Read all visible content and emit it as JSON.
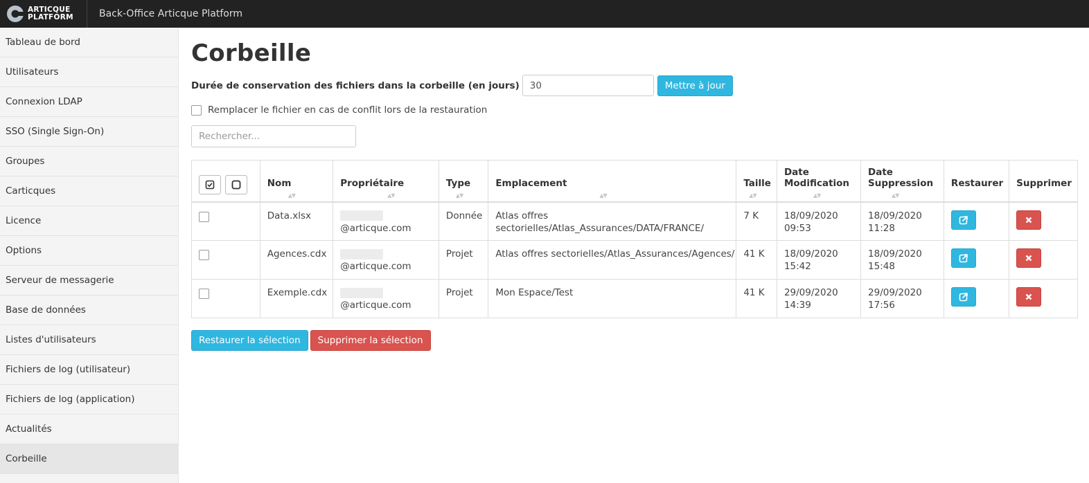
{
  "brand": {
    "logo_line1": "ARTICQUE",
    "logo_line2": "PLATFORM",
    "app_title": "Back-Office Articque Platform"
  },
  "sidebar": {
    "items": [
      {
        "label": "Tableau de bord"
      },
      {
        "label": "Utilisateurs"
      },
      {
        "label": "Connexion LDAP"
      },
      {
        "label": "SSO (Single Sign-On)"
      },
      {
        "label": "Groupes"
      },
      {
        "label": "Carticques"
      },
      {
        "label": "Licence"
      },
      {
        "label": "Options"
      },
      {
        "label": "Serveur de messagerie"
      },
      {
        "label": "Base de données"
      },
      {
        "label": "Listes d'utilisateurs"
      },
      {
        "label": "Fichiers de log (utilisateur)"
      },
      {
        "label": "Fichiers de log (application)"
      },
      {
        "label": "Actualités"
      },
      {
        "label": "Corbeille",
        "active": true
      }
    ]
  },
  "main": {
    "title": "Corbeille",
    "retention_label": "Durée de conservation des fichiers dans la corbeille (en jours)",
    "retention_value": "30",
    "update_button": "Mettre à jour",
    "conflict_label": "Remplacer le fichier en cas de conflit lors de la restauration",
    "search_placeholder": "Rechercher...",
    "table": {
      "headers": {
        "name": "Nom",
        "owner": "Propriétaire",
        "type": "Type",
        "location": "Emplacement",
        "size": "Taille",
        "modified_1": "Date",
        "modified_2": "Modification",
        "deleted_1": "Date",
        "deleted_2": "Suppression",
        "restore": "Restaurer",
        "delete": "Supprimer"
      },
      "rows": [
        {
          "name": "Data.xlsx",
          "owner": "@articque.com",
          "type": "Donnée",
          "location": "Atlas offres sectorielles/Atlas_Assurances/DATA/FRANCE/",
          "size": "7 K",
          "modified_date": "18/09/2020",
          "modified_time": "09:53",
          "deleted_date": "18/09/2020",
          "deleted_time": "11:28"
        },
        {
          "name": "Agences.cdx",
          "owner": "@articque.com",
          "type": "Projet",
          "location": "Atlas offres sectorielles/Atlas_Assurances/Agences/",
          "size": "41 K",
          "modified_date": "18/09/2020",
          "modified_time": "15:42",
          "deleted_date": "18/09/2020",
          "deleted_time": "15:48"
        },
        {
          "name": "Exemple.cdx",
          "owner": "@articque.com",
          "type": "Projet",
          "location": "Mon Espace/Test",
          "size": "41 K",
          "modified_date": "29/09/2020",
          "modified_time": "14:39",
          "deleted_date": "29/09/2020",
          "deleted_time": "17:56"
        }
      ]
    },
    "restore_selection": "Restaurer la sélection",
    "delete_selection": "Supprimer la sélection"
  },
  "colors": {
    "accent_blue": "#2fb7e0",
    "danger_red": "#d9534f",
    "topbar": "#222222"
  }
}
